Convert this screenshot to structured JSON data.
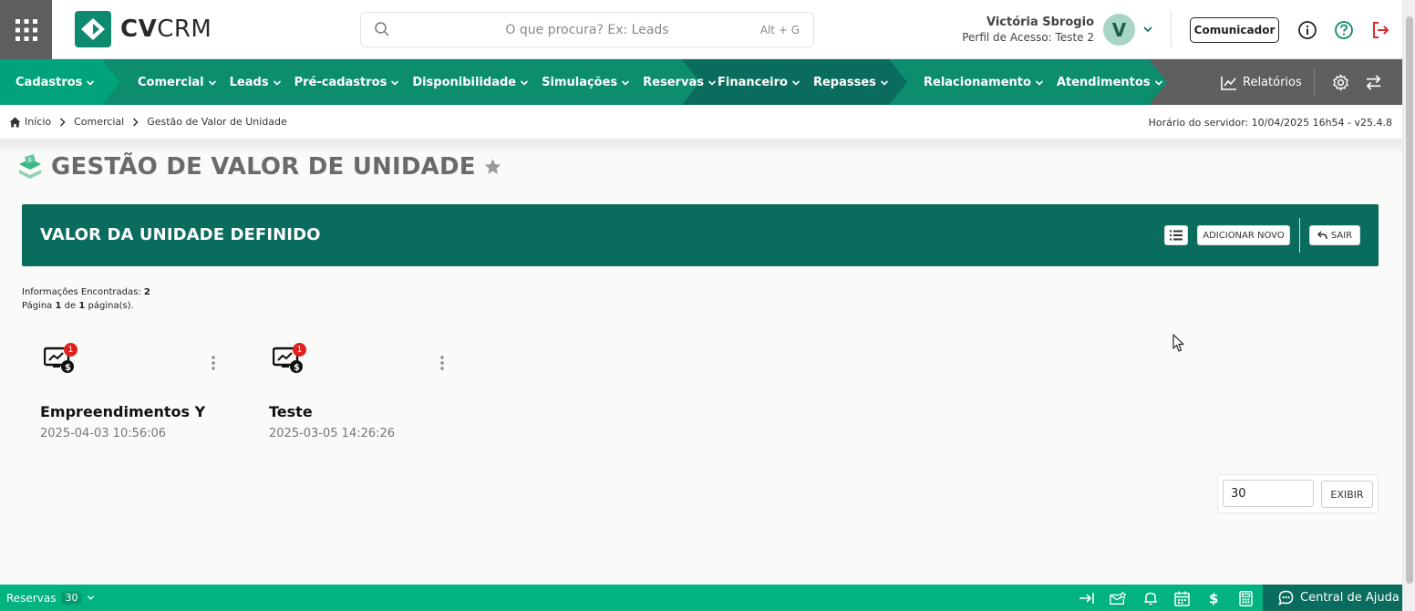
{
  "brand": {
    "logo_text_bold": "CV",
    "logo_text_light": "CRM",
    "accent": "#0a6c5d",
    "light_accent": "#00b380"
  },
  "search": {
    "placeholder": "O que procura? Ex: Leads",
    "shortcut": "Alt + G"
  },
  "user": {
    "name": "Victória Sbrogio",
    "profile": "Perfil de Acesso: Teste 2",
    "initial": "V"
  },
  "header": {
    "comunicador_label": "Comunicador",
    "icons": [
      "info-icon",
      "help-icon",
      "logout-icon"
    ]
  },
  "nav": {
    "group1": [
      "Cadastros"
    ],
    "group2": [
      "Comercial",
      "Leads",
      "Pré-cadastros",
      "Disponibilidade",
      "Simulações",
      "Reservas"
    ],
    "group3": [
      "Financeiro",
      "Repasses"
    ],
    "group4": [
      "Relacionamento",
      "Atendimentos"
    ],
    "reports": "Relatórios"
  },
  "breadcrumb": {
    "items": [
      "Início",
      "Comercial",
      "Gestão de Valor de Unidade"
    ],
    "server_time": "Horário do servidor: 10/04/2025 16h54 - v25.4.8"
  },
  "page": {
    "title": "GESTÃO DE VALOR DE UNIDADE"
  },
  "panel": {
    "title": "VALOR DA UNIDADE DEFINIDO",
    "add_label": "ADICIONAR NOVO",
    "exit_label": "SAIR"
  },
  "info": {
    "found_label": "Informações Encontradas:",
    "found_count": "2",
    "page_prefix": "Página",
    "page_current": "1",
    "page_of": "de",
    "page_total": "1",
    "page_suffix": "página(s)."
  },
  "cards": [
    {
      "name": "Empreendimentos Y",
      "date": "2025-04-03 10:56:06",
      "badge": "1"
    },
    {
      "name": "Teste",
      "date": "2025-03-05 14:26:26",
      "badge": "1"
    }
  ],
  "pagination": {
    "per_page": "30",
    "show_label": "EXIBIR"
  },
  "footer": {
    "module": "Reservas",
    "count": "30",
    "help_label": "Central de Ajuda"
  }
}
